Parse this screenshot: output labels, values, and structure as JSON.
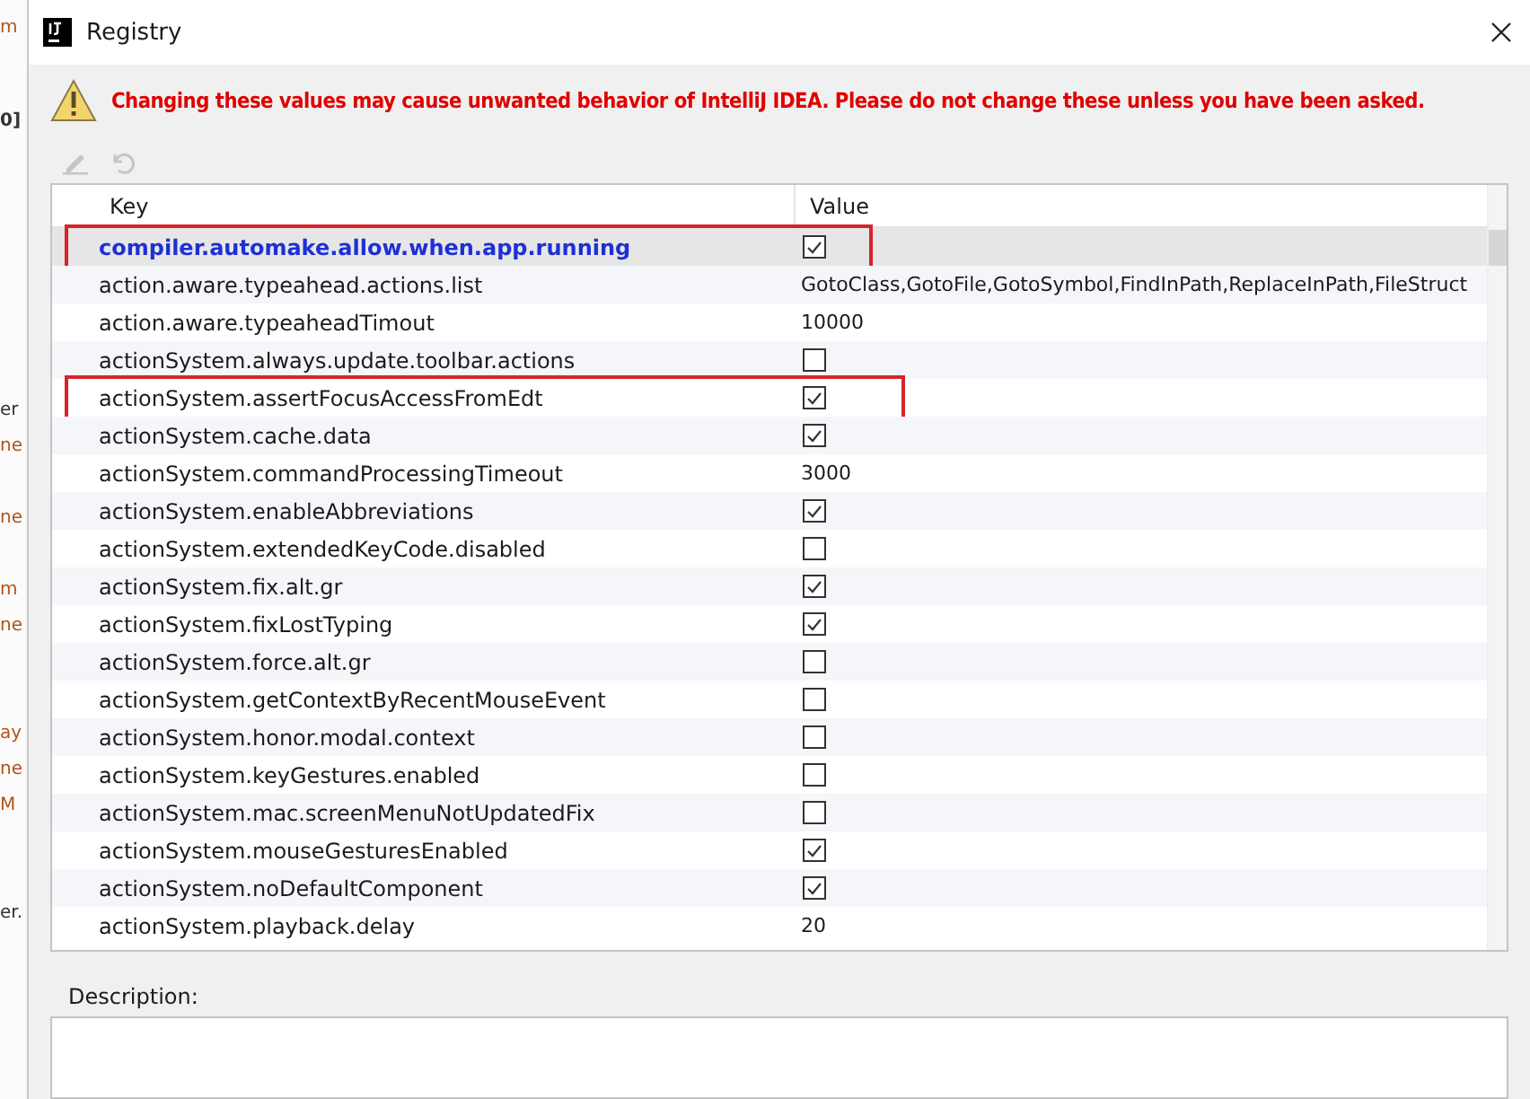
{
  "background_fragments": [
    {
      "text": "m",
      "kind": "orange"
    },
    {
      "text": "0]",
      "kind": "bold"
    },
    {
      "text": "er",
      "kind": "plain"
    },
    {
      "text": "ne",
      "kind": "orange"
    },
    {
      "text": "ne",
      "kind": "orange"
    },
    {
      "text": "m",
      "kind": "orange"
    },
    {
      "text": "ne",
      "kind": "orange"
    },
    {
      "text": "ay",
      "kind": "orange"
    },
    {
      "text": "ne",
      "kind": "orange"
    },
    {
      "text": "M",
      "kind": "orange"
    },
    {
      "text": "er.",
      "kind": "plain"
    }
  ],
  "window": {
    "title": "Registry"
  },
  "warning": "Changing these values may cause unwanted behavior of IntelliJ IDEA. Please do not change these unless you have been asked.",
  "toolbar": {
    "edit_disabled": true,
    "revert_disabled": true
  },
  "table": {
    "columns": [
      "Key",
      "Value"
    ],
    "rows": [
      {
        "key": "compiler.automake.allow.when.app.running",
        "kind": "checkbox",
        "checked": true,
        "selected": true,
        "annotated": true
      },
      {
        "key": "action.aware.typeahead.actions.list",
        "kind": "text",
        "value": "GotoClass,GotoFile,GotoSymbol,FindInPath,ReplaceInPath,FileStruct",
        "selected": false,
        "annotated": false
      },
      {
        "key": "action.aware.typeaheadTimout",
        "kind": "text",
        "value": "10000",
        "selected": false,
        "annotated": false
      },
      {
        "key": "actionSystem.always.update.toolbar.actions",
        "kind": "checkbox",
        "checked": false,
        "selected": false,
        "annotated": false
      },
      {
        "key": "actionSystem.assertFocusAccessFromEdt",
        "kind": "checkbox",
        "checked": true,
        "selected": false,
        "annotated": true
      },
      {
        "key": "actionSystem.cache.data",
        "kind": "checkbox",
        "checked": true,
        "selected": false,
        "annotated": false
      },
      {
        "key": "actionSystem.commandProcessingTimeout",
        "kind": "text",
        "value": "3000",
        "selected": false,
        "annotated": false
      },
      {
        "key": "actionSystem.enableAbbreviations",
        "kind": "checkbox",
        "checked": true,
        "selected": false,
        "annotated": false
      },
      {
        "key": "actionSystem.extendedKeyCode.disabled",
        "kind": "checkbox",
        "checked": false,
        "selected": false,
        "annotated": false
      },
      {
        "key": "actionSystem.fix.alt.gr",
        "kind": "checkbox",
        "checked": true,
        "selected": false,
        "annotated": false
      },
      {
        "key": "actionSystem.fixLostTyping",
        "kind": "checkbox",
        "checked": true,
        "selected": false,
        "annotated": false
      },
      {
        "key": "actionSystem.force.alt.gr",
        "kind": "checkbox",
        "checked": false,
        "selected": false,
        "annotated": false
      },
      {
        "key": "actionSystem.getContextByRecentMouseEvent",
        "kind": "checkbox",
        "checked": false,
        "selected": false,
        "annotated": false
      },
      {
        "key": "actionSystem.honor.modal.context",
        "kind": "checkbox",
        "checked": false,
        "selected": false,
        "annotated": false
      },
      {
        "key": "actionSystem.keyGestures.enabled",
        "kind": "checkbox",
        "checked": false,
        "selected": false,
        "annotated": false
      },
      {
        "key": "actionSystem.mac.screenMenuNotUpdatedFix",
        "kind": "checkbox",
        "checked": false,
        "selected": false,
        "annotated": false
      },
      {
        "key": "actionSystem.mouseGesturesEnabled",
        "kind": "checkbox",
        "checked": true,
        "selected": false,
        "annotated": false
      },
      {
        "key": "actionSystem.noDefaultComponent",
        "kind": "checkbox",
        "checked": true,
        "selected": false,
        "annotated": false
      },
      {
        "key": "actionSystem.playback.delay",
        "kind": "text",
        "value": "20",
        "selected": false,
        "annotated": false
      }
    ]
  },
  "description": {
    "label": "Description:"
  }
}
